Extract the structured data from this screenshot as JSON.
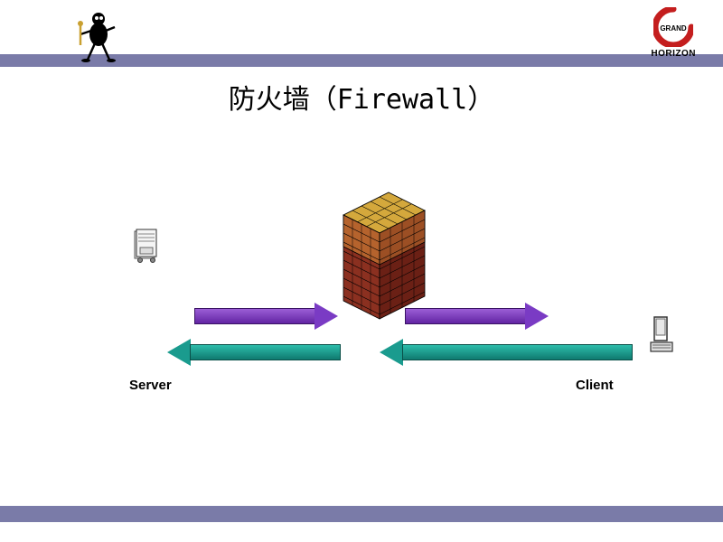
{
  "title": "防火墙（Firewall）",
  "labels": {
    "server": "Server",
    "client": "Client"
  },
  "logo": {
    "inner": "GRAND",
    "bottom": "HORIZON"
  },
  "colors": {
    "purple_arrow": "#7a3bc4",
    "teal_arrow": "#1a9b8e",
    "bar": "#7a7ba8"
  }
}
